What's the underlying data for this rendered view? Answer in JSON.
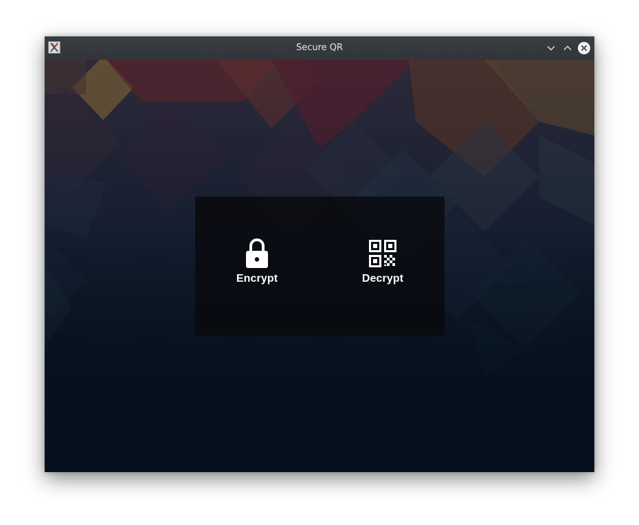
{
  "window": {
    "title": "Secure QR",
    "controls": {
      "minimize_icon": "chevron-down-icon",
      "maximize_icon": "chevron-up-icon",
      "close_icon": "close-icon"
    }
  },
  "actions": [
    {
      "label": "Encrypt",
      "icon": "lock-icon"
    },
    {
      "label": "Decrypt",
      "icon": "qr-code-icon"
    }
  ],
  "colors": {
    "titlebar": "#33373c",
    "card_background": "#0a0c10",
    "label_text": "#ffffff",
    "background_top": "#2e2a3a",
    "background_bottom": "#061120"
  }
}
